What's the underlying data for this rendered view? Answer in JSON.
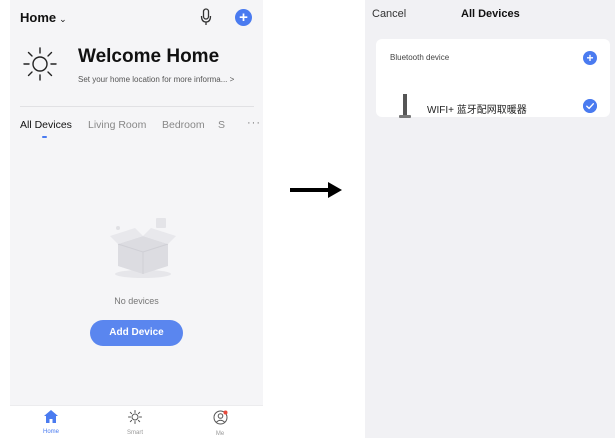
{
  "left": {
    "header": {
      "home_label": "Home",
      "chevron": "⌄"
    },
    "welcome": {
      "title": "Welcome Home",
      "subtitle": "Set your home location for more informa...  >"
    },
    "tabs": [
      {
        "label": "All Devices",
        "active": true
      },
      {
        "label": "Living Room",
        "active": false
      },
      {
        "label": "Bedroom",
        "active": false
      },
      {
        "label": "S",
        "active": false
      }
    ],
    "tabs_more": "···",
    "empty_state": {
      "message": "No devices",
      "button_label": "Add Device"
    },
    "bottom_nav": [
      {
        "label": "Home",
        "icon": "home-icon",
        "active": true
      },
      {
        "label": "Smart",
        "icon": "sun-icon",
        "active": false
      },
      {
        "label": "Me",
        "icon": "profile-icon",
        "active": false
      }
    ],
    "accent_color": "#4a7bf0"
  },
  "right": {
    "header": {
      "cancel_label": "Cancel",
      "title": "All Devices"
    },
    "section_label": "Bluetooth device",
    "device": {
      "name": "WIFI+ 蓝牙配网取暖器",
      "checked": true
    }
  }
}
